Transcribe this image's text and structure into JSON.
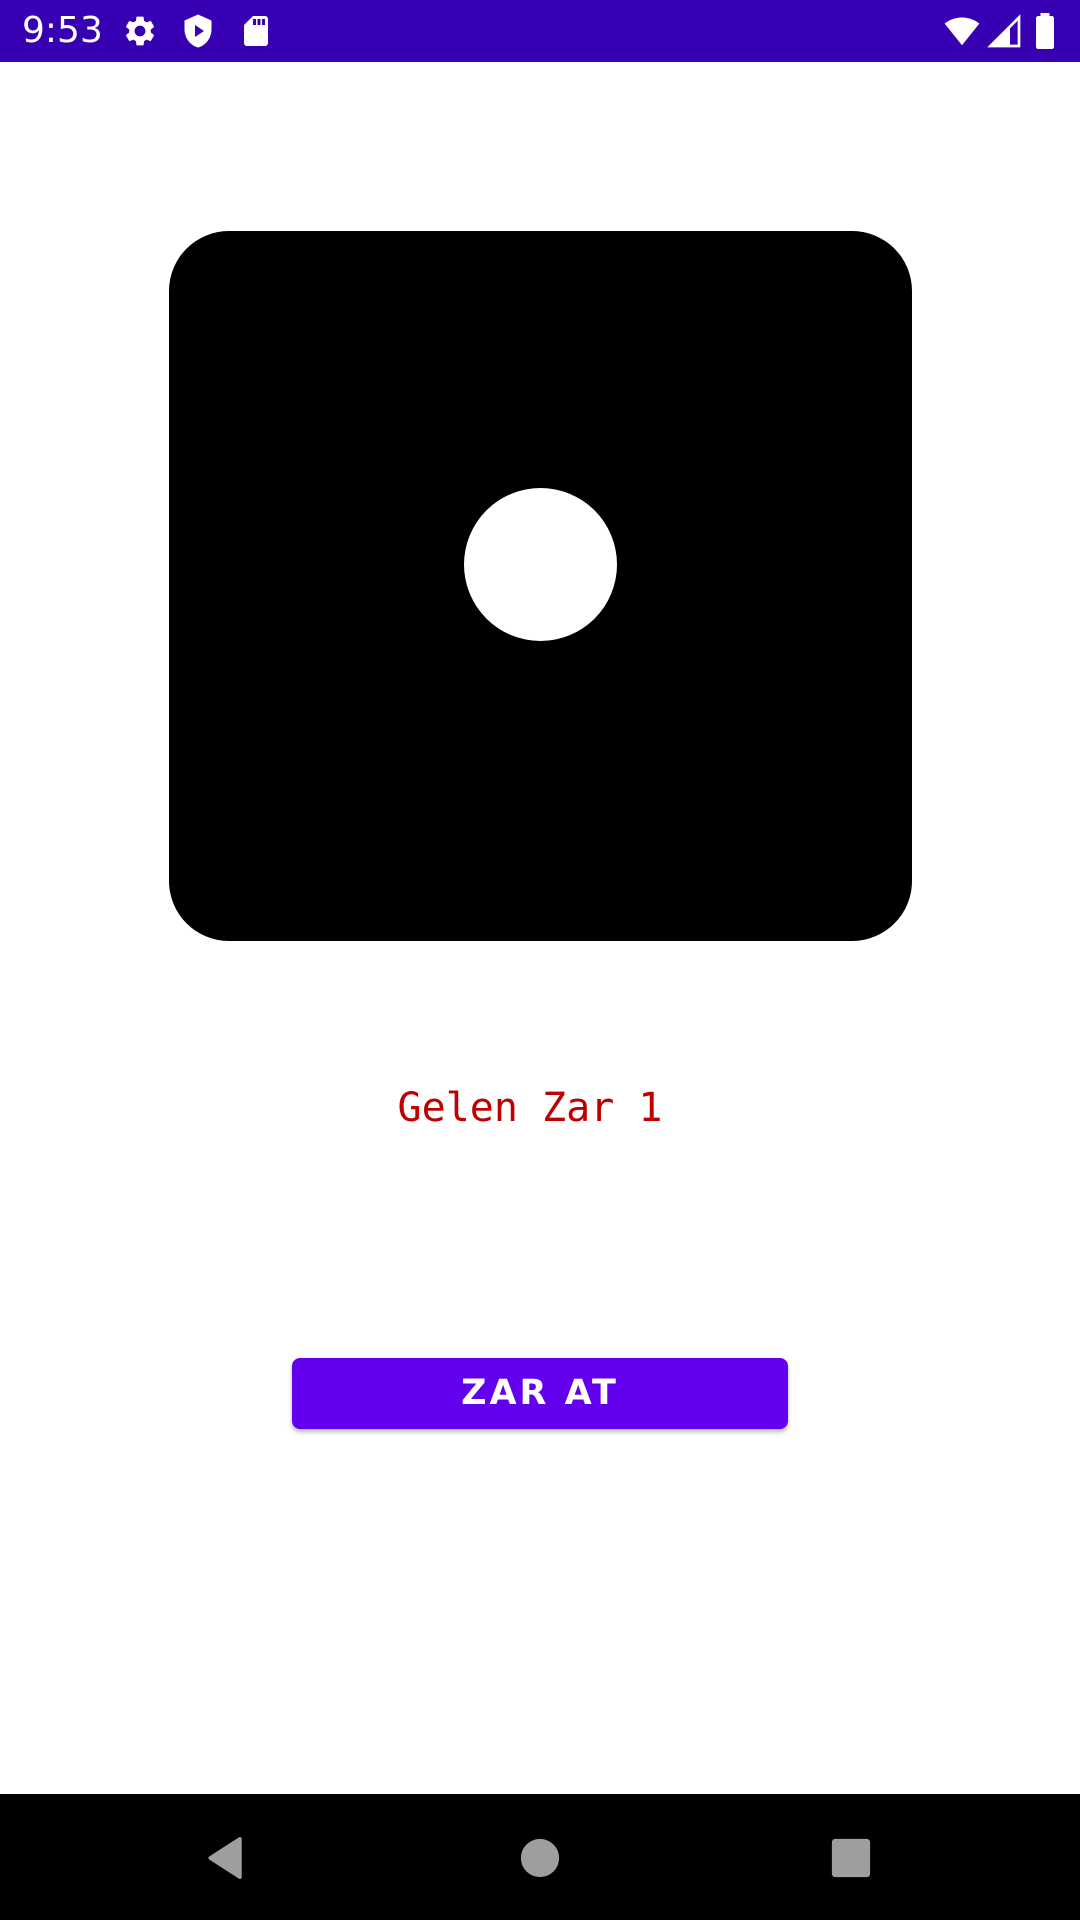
{
  "status_bar": {
    "time": "9:53",
    "icons_left": [
      "settings-icon",
      "shield-play-icon",
      "sd-card-icon"
    ],
    "icons_right": [
      "wifi-icon",
      "cell-signal-icon",
      "battery-icon"
    ],
    "background": "#3700b3"
  },
  "dice": {
    "face_value": 1,
    "color": "#000000",
    "pip_color": "#ffffff"
  },
  "result": {
    "text": "Gelen Zar 1",
    "color": "#c00000"
  },
  "roll_button": {
    "label": "ZAR AT",
    "color": "#6200ee"
  },
  "nav_bar": {
    "buttons": [
      "back-icon",
      "home-icon",
      "recents-icon"
    ]
  }
}
